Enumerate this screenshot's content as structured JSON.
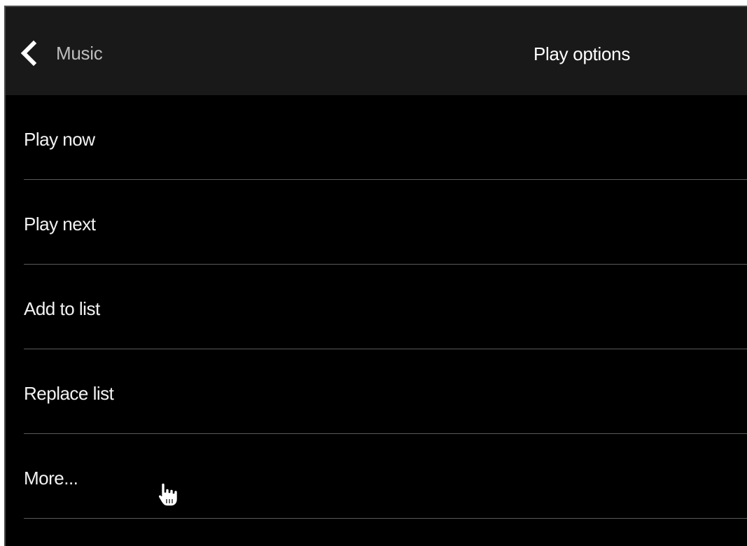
{
  "header": {
    "back_label": "Music",
    "title": "Play options",
    "back_icon": "chevron-left-icon"
  },
  "menu": {
    "items": [
      {
        "label": "Play now"
      },
      {
        "label": "Play next"
      },
      {
        "label": "Add to list"
      },
      {
        "label": "Replace list"
      },
      {
        "label": "More..."
      }
    ]
  },
  "cursor": {
    "icon": "hand-pointer-icon"
  },
  "colors": {
    "background": "#000000",
    "header_background": "#191919",
    "text": "#f2f2f2",
    "back_label_text": "#bdbdbd",
    "divider": "#5a5a5a"
  }
}
